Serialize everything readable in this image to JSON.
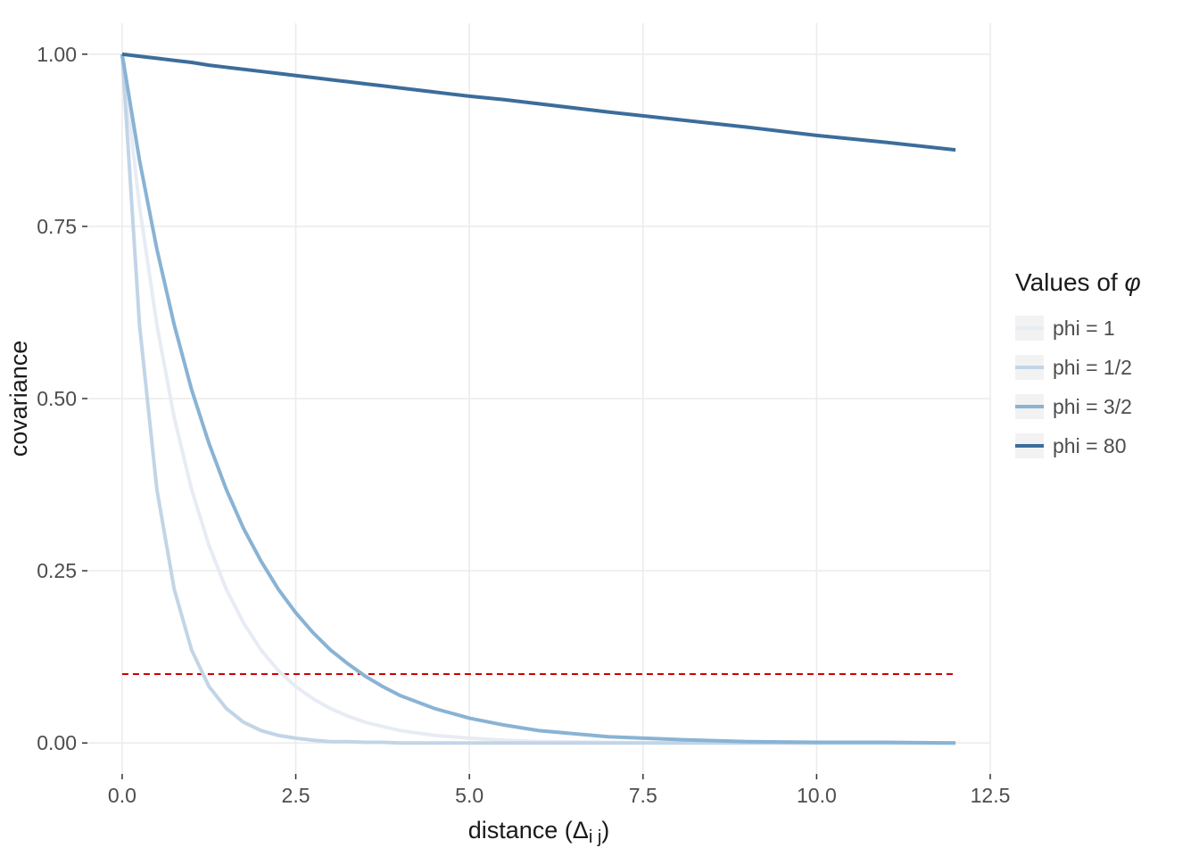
{
  "chart_data": {
    "type": "line",
    "title": "",
    "xlabel": "distance (Δᵢⱼ)",
    "ylabel": "covariance",
    "xlim": [
      0,
      12
    ],
    "ylim": [
      0,
      1
    ],
    "x_ticks": [
      0.0,
      2.5,
      5.0,
      7.5,
      10.0,
      12.5
    ],
    "y_ticks": [
      0.0,
      0.25,
      0.5,
      0.75,
      1.0
    ],
    "x_tick_labels": [
      "0.0",
      "2.5",
      "5.0",
      "7.5",
      "10.0",
      "12.5"
    ],
    "y_tick_labels": [
      "0.00",
      "0.25",
      "0.50",
      "0.75",
      "1.00"
    ],
    "x": [
      0,
      0.25,
      0.5,
      0.75,
      1,
      1.25,
      1.5,
      1.75,
      2,
      2.25,
      2.5,
      2.75,
      3,
      3.25,
      3.5,
      3.75,
      4,
      4.5,
      5,
      5.5,
      6,
      7,
      8,
      9,
      10,
      11,
      12
    ],
    "series": [
      {
        "name": "phi = 1",
        "phi": 1,
        "color": "#e7ecf4",
        "values": [
          1.0,
          0.779,
          0.607,
          0.472,
          0.368,
          0.287,
          0.223,
          0.174,
          0.135,
          0.105,
          0.082,
          0.064,
          0.05,
          0.039,
          0.03,
          0.024,
          0.018,
          0.011,
          0.007,
          0.004,
          0.002,
          0.001,
          0.0,
          0.0,
          0.0,
          0.0,
          0.0
        ]
      },
      {
        "name": "phi = 1/2",
        "phi": 0.5,
        "color": "#c2d5e7",
        "values": [
          1.0,
          0.607,
          0.368,
          0.223,
          0.135,
          0.082,
          0.05,
          0.03,
          0.018,
          0.011,
          0.007,
          0.004,
          0.002,
          0.002,
          0.001,
          0.001,
          0.0,
          0.0,
          0.0,
          0.0,
          0.0,
          0.0,
          0.0,
          0.0,
          0.0,
          0.0,
          0.0
        ]
      },
      {
        "name": "phi = 3/2",
        "phi": 1.5,
        "color": "#89b3d4",
        "values": [
          1.0,
          0.846,
          0.717,
          0.607,
          0.513,
          0.435,
          0.368,
          0.311,
          0.264,
          0.223,
          0.189,
          0.16,
          0.135,
          0.115,
          0.097,
          0.082,
          0.069,
          0.05,
          0.036,
          0.026,
          0.018,
          0.009,
          0.005,
          0.002,
          0.001,
          0.001,
          0.0
        ]
      },
      {
        "name": "phi = 80",
        "phi": 80,
        "color": "#3c6d9b",
        "values": [
          1.0,
          0.997,
          0.994,
          0.991,
          0.988,
          0.984,
          0.981,
          0.978,
          0.975,
          0.972,
          0.969,
          0.966,
          0.963,
          0.96,
          0.957,
          0.954,
          0.951,
          0.945,
          0.939,
          0.934,
          0.928,
          0.916,
          0.905,
          0.894,
          0.882,
          0.872,
          0.861
        ]
      }
    ],
    "reference_line": {
      "y": 0.1,
      "color": "#cc0000",
      "style": "dashed"
    },
    "legend": {
      "title": "Values of φ",
      "entries": [
        "phi = 1",
        "phi = 1/2",
        "phi = 3/2",
        "phi = 80"
      ]
    }
  }
}
